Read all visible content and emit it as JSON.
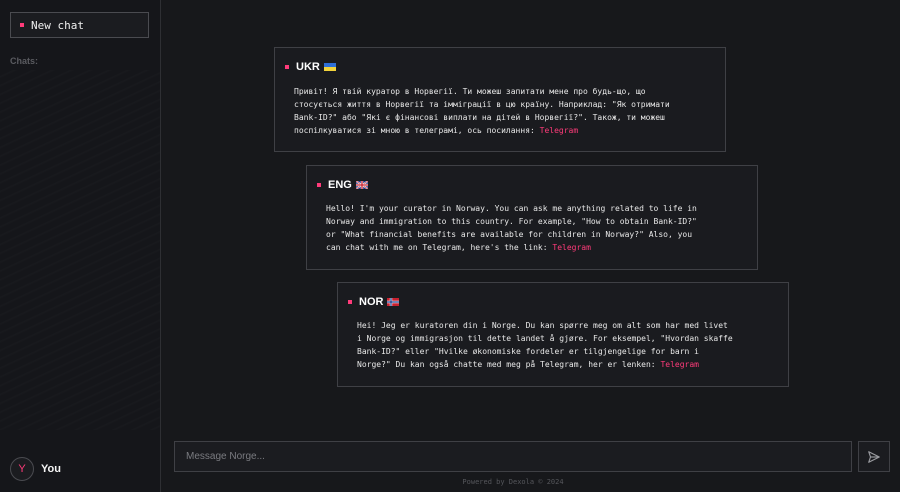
{
  "sidebar": {
    "new_chat_label": "New chat",
    "chats_label": "Chats:",
    "user": {
      "avatar_initial": "Y",
      "name": "You"
    }
  },
  "messages": [
    {
      "lang": "UKR",
      "flag": "ukraine-flag",
      "body": "Привіт! Я твій куратор в Норвегії. Ти можеш запитати мене про будь-що, що\nстосується життя в Норвегії та імміграції в цю країну. Наприклад: \"Як отримати\nBank-ID?\" або \"Які є фінансові виплати на дітей в Норвегії?\". Також, ти можеш\nпоспілкуватися зі мною в телеграмі, ось посилання: ",
      "link": "Telegram"
    },
    {
      "lang": "ENG",
      "flag": "uk-flag",
      "body": "Hello! I'm your curator in Norway. You can ask me anything related to life in\nNorway and immigration to this country. For example, \"How to obtain Bank-ID?\"\nor \"What financial benefits are available for children in Norway?\" Also, you\ncan chat with me on Telegram, here's the link: ",
      "link": "Telegram"
    },
    {
      "lang": "NOR",
      "flag": "norway-flag",
      "body": "Hei! Jeg er kuratoren din i Norge. Du kan spørre meg om alt som har med livet\ni Norge og immigrasjon til dette landet å gjøre. For eksempel, \"Hvordan skaffe\nBank-ID?\" eller \"Hvilke økonomiske fordeler er tilgjengelige for barn i\nNorge?\" Du kan også chatte med meg på Telegram, her er lenken: ",
      "link": "Telegram"
    }
  ],
  "composer": {
    "placeholder": "Message Norge..."
  },
  "footer": {
    "text": "Powered by Dexola © 2024"
  },
  "colors": {
    "accent": "#ff3b7a",
    "background": "#17181b",
    "border": "#3f4045"
  }
}
